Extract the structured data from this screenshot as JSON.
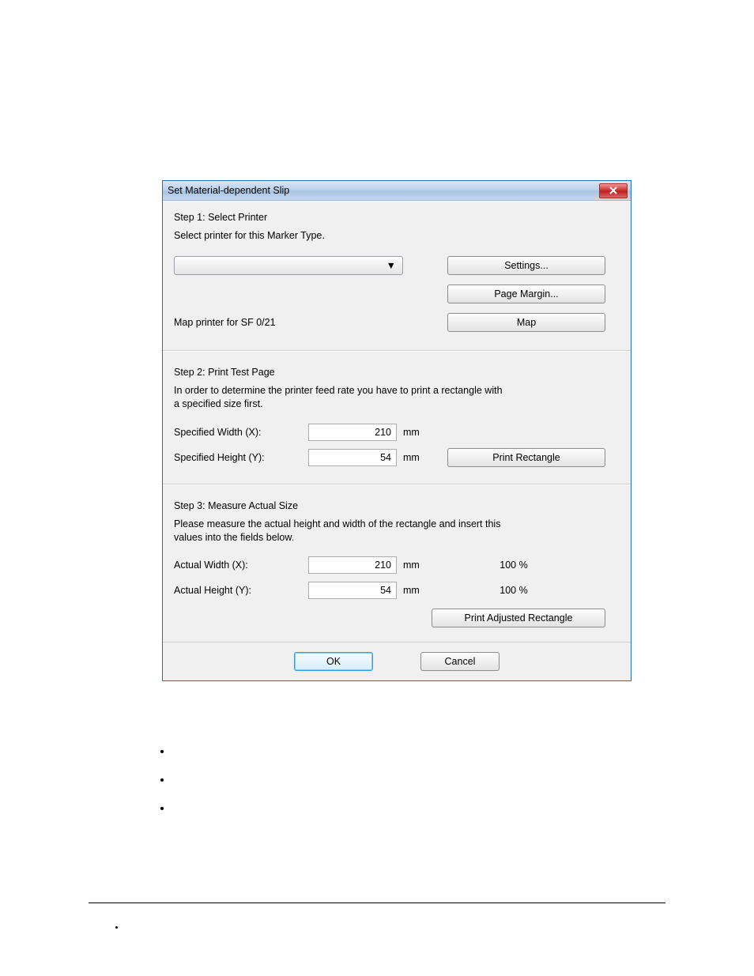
{
  "dialog": {
    "title": "Set Material-dependent Slip",
    "step1": {
      "heading": "Step 1: Select Printer",
      "instruction": "Select printer for this Marker Type.",
      "settings_label": "Settings...",
      "page_margin_label": "Page Margin...",
      "map_label_text": "Map printer for SF 0/21",
      "map_button": "Map"
    },
    "step2": {
      "heading": "Step 2: Print Test Page",
      "instruction": "In order to determine the printer feed rate you have to print a rectangle with a specified size first.",
      "width_label": "Specified Width (X):",
      "width_value": "210",
      "height_label": "Specified Height (Y):",
      "height_value": "54",
      "unit": "mm",
      "print_rect_label": "Print Rectangle"
    },
    "step3": {
      "heading": "Step 3: Measure Actual Size",
      "instruction": "Please measure the actual height and width of the rectangle and insert this values into the fields below.",
      "width_label": "Actual Width (X):",
      "width_value": "210",
      "width_pct": "100 %",
      "height_label": "Actual Height (Y):",
      "height_value": "54",
      "height_pct": "100 %",
      "unit": "mm",
      "print_adj_label": "Print Adjusted Rectangle"
    },
    "ok_label": "OK",
    "cancel_label": "Cancel"
  }
}
